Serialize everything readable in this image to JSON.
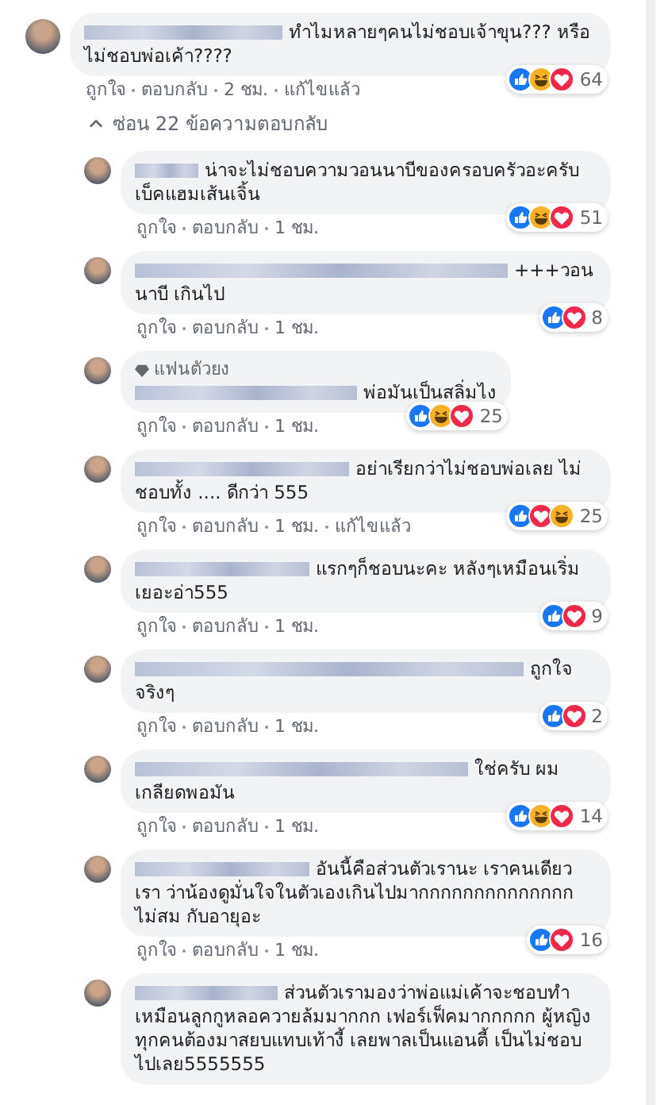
{
  "comments": [
    {
      "text": "ทำไมหลายๆคนไม่ชอบเจ้าขุน??? หรือ ไม่ชอบพ่อเค้า????",
      "reactions": [
        {
          "kind": "like"
        },
        {
          "kind": "haha"
        },
        {
          "kind": "love"
        }
      ],
      "reaction_count": "64",
      "actions": [
        "ถูกใจ",
        "ตอบกลับ"
      ],
      "time": "2 ชม.",
      "edited": "แก้ไขแล้ว"
    }
  ],
  "toggle_replies": "ซ่อน 22 ข้อความตอบกลับ",
  "replies": [
    {
      "text": "น่าจะไม่ชอบความวอนนาบีของครอบครัวอะครับ เบ็คแฮมเส้นเจิ้น",
      "reactions": [
        {
          "kind": "like"
        },
        {
          "kind": "haha"
        },
        {
          "kind": "love"
        }
      ],
      "reaction_count": "51",
      "actions": [
        "ถูกใจ",
        "ตอบกลับ"
      ],
      "time": "1 ชม."
    },
    {
      "text": "+++วอนนาบี เกินไป",
      "reactions": [
        {
          "kind": "like"
        },
        {
          "kind": "love"
        }
      ],
      "reaction_count": "8",
      "actions": [
        "ถูกใจ",
        "ตอบกลับ"
      ],
      "time": "1 ชม."
    },
    {
      "badge": "แฟนตัวยง",
      "text": "พ่อมันเป็นสลิ่มไง",
      "reactions": [
        {
          "kind": "like"
        },
        {
          "kind": "haha"
        },
        {
          "kind": "love"
        }
      ],
      "reaction_count": "25",
      "actions": [
        "ถูกใจ",
        "ตอบกลับ"
      ],
      "time": "1 ชม."
    },
    {
      "text": "อย่าเรียกว่าไม่ชอบพ่อเลย ไม่ ชอบทั้ง .... ดีกว่า 555",
      "reactions": [
        {
          "kind": "like"
        },
        {
          "kind": "love"
        },
        {
          "kind": "haha"
        }
      ],
      "reaction_count": "25",
      "actions": [
        "ถูกใจ",
        "ตอบกลับ"
      ],
      "time": "1 ชม.",
      "edited": "แก้ไขแล้ว"
    },
    {
      "text": "แรกๆก็ชอบนะคะ หลังๆเหมือนเริ่ม เยอะอ่า555",
      "reactions": [
        {
          "kind": "like"
        },
        {
          "kind": "love"
        }
      ],
      "reaction_count": "9",
      "actions": [
        "ถูกใจ",
        "ตอบกลับ"
      ],
      "time": "1 ชม."
    },
    {
      "text": "ถูกใจจริงๆ",
      "reactions": [
        {
          "kind": "like"
        },
        {
          "kind": "love"
        }
      ],
      "reaction_count": "2",
      "actions": [
        "ถูกใจ",
        "ตอบกลับ"
      ],
      "time": "1 ชม."
    },
    {
      "text": "ใช่ครับ ผม เกลียดพอมัน",
      "reactions": [
        {
          "kind": "like"
        },
        {
          "kind": "haha"
        },
        {
          "kind": "love"
        }
      ],
      "reaction_count": "14",
      "actions": [
        "ถูกใจ",
        "ตอบกลับ"
      ],
      "time": "1 ชม."
    },
    {
      "text": "อันนี้คือส่วนตัวเรานะ เราคนเดียว เรา ว่าน้องดูมั่นใจในตัวเองเกินไปมากกกกกกกกกกกกกก ไม่สม กับอายุอะ",
      "reactions": [
        {
          "kind": "like"
        },
        {
          "kind": "love"
        }
      ],
      "reaction_count": "16",
      "actions": [
        "ถูกใจ",
        "ตอบกลับ"
      ],
      "time": "1 ชม."
    },
    {
      "text": "ส่วนตัวเรามองว่าพ่อแม่เค้าจะชอบทำ เหมือนลูกกูหลอควายล้มมากกก เฟอร์เฟ็คมากกกกก ผู้หญิง ทุกคนต้องมาสยบแทบเท้างี้ เลยพาลเป็นแอนตี้ เป็นไม่ชอบ ไปเลย5555555"
    }
  ]
}
